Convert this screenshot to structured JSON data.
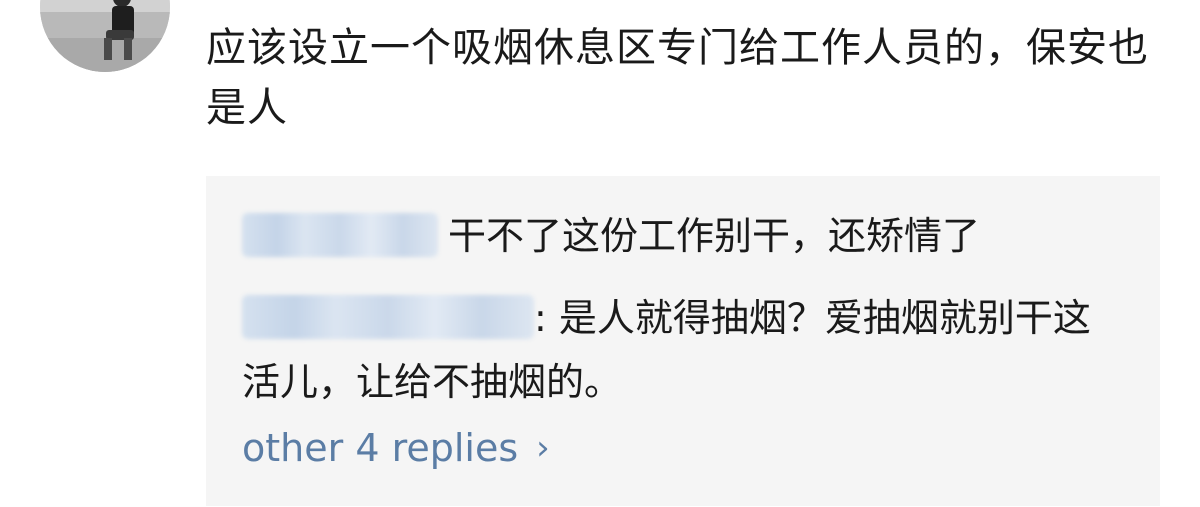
{
  "comment": {
    "text": "应该设立一个吸烟休息区专门给工作人员的，保安也是人"
  },
  "replies": [
    {
      "author": "",
      "text": "干不了这份工作别干，还矫情了"
    },
    {
      "author": "",
      "separator": ": ",
      "text": "是人就得抽烟？爱抽烟就别干这活儿，让给不抽烟的。"
    }
  ],
  "more_replies": {
    "label": "other 4 replies",
    "icon": "chevron-right-icon",
    "color": "#5b7da5"
  },
  "colors": {
    "panel_background": "#f5f5f5",
    "text": "#1a1a1a"
  }
}
